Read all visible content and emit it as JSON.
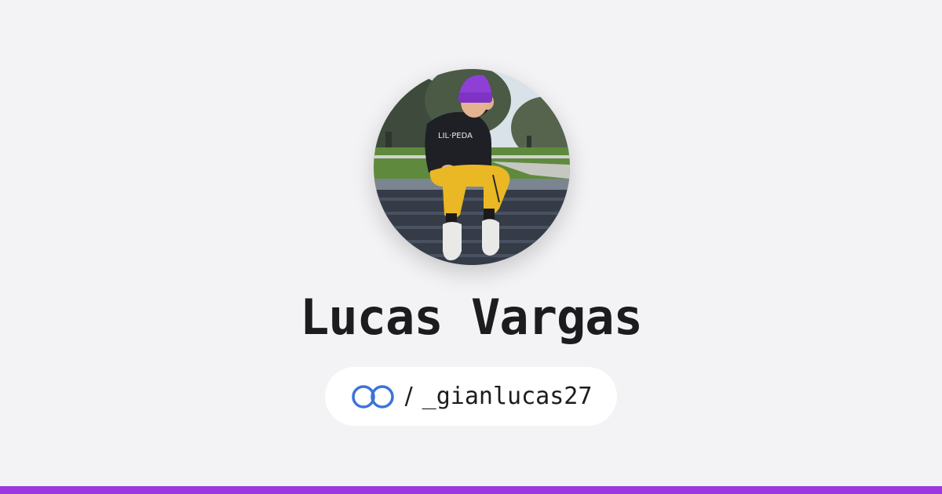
{
  "profile": {
    "name": "Lucas Vargas",
    "separator": "/",
    "handle": "_gianlucas27",
    "avatar_icon": "profile-photo"
  },
  "link_icon": "linked-rings-icon",
  "colors": {
    "background": "#f3f3f5",
    "accent": "#9b38e0",
    "link_icon": "#3b73d9",
    "text": "#1c1c1e",
    "pill": "#ffffff"
  }
}
